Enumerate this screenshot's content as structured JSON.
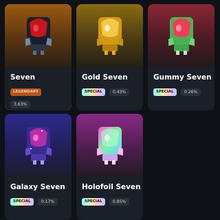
{
  "cards": [
    {
      "name": "Seven",
      "tag": "LEGENDARY",
      "percent": "3.63%",
      "selected": true
    },
    {
      "name": "Gold Seven",
      "tag": "SPECIAL",
      "percent": "0.43%"
    },
    {
      "name": "Gummy Seven",
      "tag": "SPECIAL",
      "percent": "0.26%"
    },
    {
      "name": "Galaxy Seven",
      "tag": "SPECIAL",
      "percent": "0.17%"
    },
    {
      "name": "Holofoil Seven",
      "tag": "SPECIAL",
      "percent": "0.85%"
    }
  ],
  "colors": {
    "seven_bg": "#9a5a12",
    "gold_bg": "#8a6b12",
    "gummy_bg": "#8b2636",
    "galaxy_bg": "#2d2a8a",
    "holofoil_bg": "#8b2a86",
    "legendary_badge": "#b4551f"
  },
  "icons": [
    "robot-head-icon"
  ]
}
